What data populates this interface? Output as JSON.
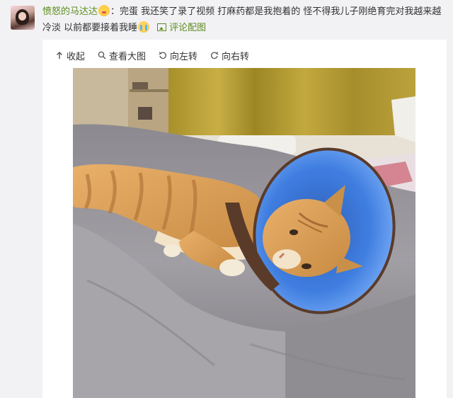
{
  "comment": {
    "username": "愤怒的马达达",
    "text_part1": "：完蛋 我还笑了录了视频 打麻药都是我抱着的 怪不得我儿子刚绝育完对我越来越冷淡 以前都要接着我睡",
    "emoji_1": "kiss-emoji",
    "emoji_2": "crying-emoji",
    "pic_link_label": "评论配图"
  },
  "toolbar": {
    "collapse_label": "收起",
    "view_large_label": "查看大图",
    "rotate_left_label": "向左转",
    "rotate_right_label": "向右转"
  },
  "icons": {
    "collapse": "arrow-up-icon",
    "view_large": "magnifier-icon",
    "rotate_left": "rotate-left-icon",
    "rotate_right": "rotate-right-icon",
    "picture": "picture-icon"
  },
  "colors": {
    "username": "#5c8c1c",
    "page_background": "#f2f2f5",
    "panel_background": "#ffffff",
    "cone_blue": "#3f7ee0"
  },
  "photo": {
    "alt": "orange tabby cat wearing a blue cone lying on a gray bed"
  }
}
